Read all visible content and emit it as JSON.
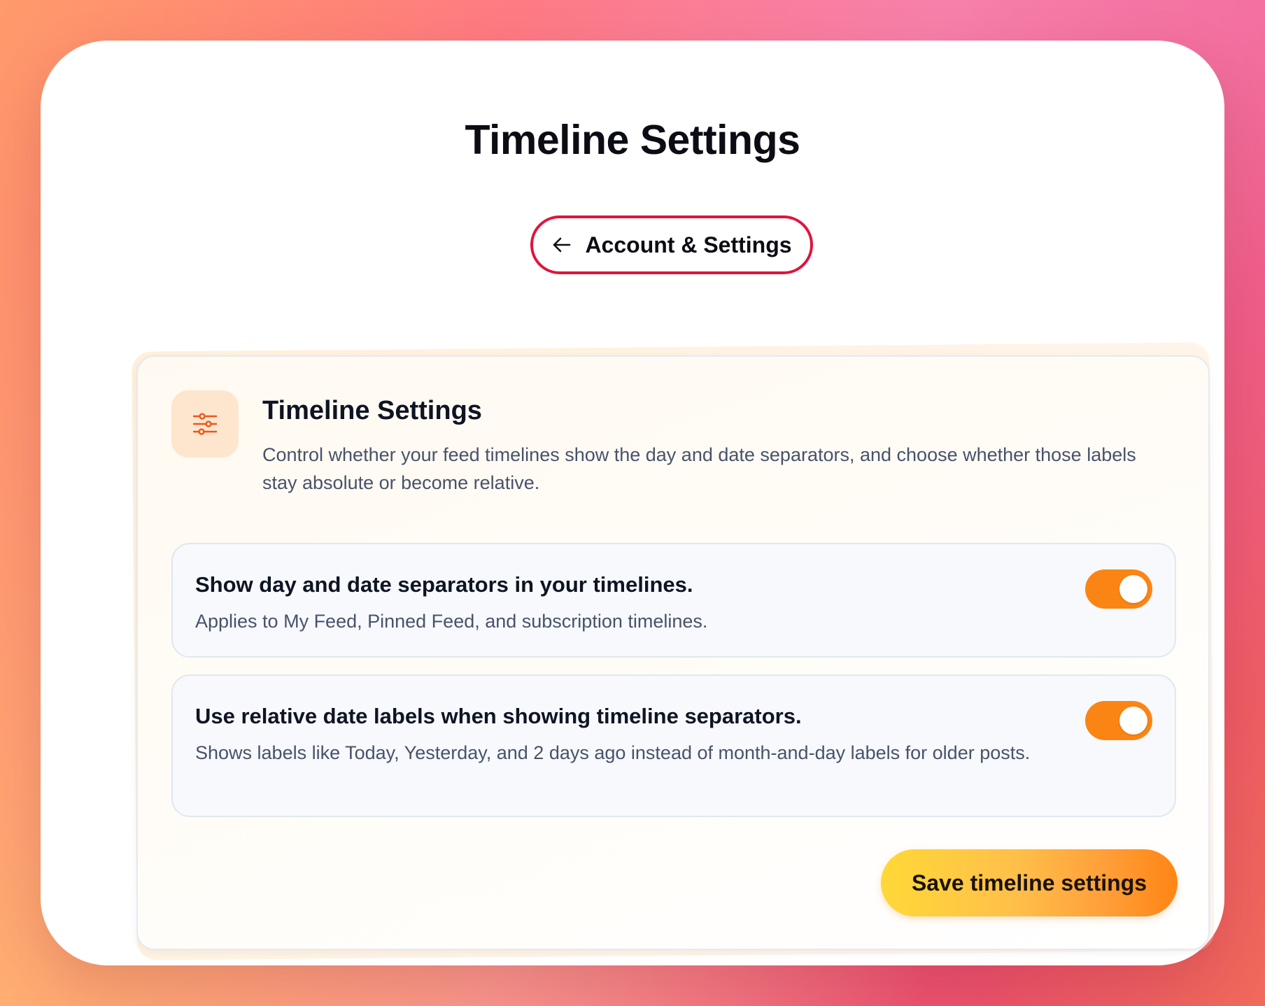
{
  "header": {
    "title": "Timeline Settings",
    "back_button_label": "Account & Settings"
  },
  "card": {
    "icon": "sliders-icon",
    "title": "Timeline Settings",
    "description": "Control whether your feed timelines show the day and date separators, and choose whether those labels stay absolute or become relative."
  },
  "settings": [
    {
      "title": "Show day and date separators in your timelines.",
      "description": "Applies to My Feed, Pinned Feed, and subscription timelines.",
      "enabled": true
    },
    {
      "title": "Use relative date labels when showing timeline separators.",
      "description": "Shows labels like Today, Yesterday, and 2 days ago instead of month-and-day labels for older posts.",
      "enabled": true
    }
  ],
  "save_button_label": "Save timeline settings",
  "colors": {
    "accent_orange": "#fb8514",
    "back_button_border": "#e0143c",
    "icon_tile_bg": "#fde6cd",
    "icon_stroke": "#f0541e"
  }
}
